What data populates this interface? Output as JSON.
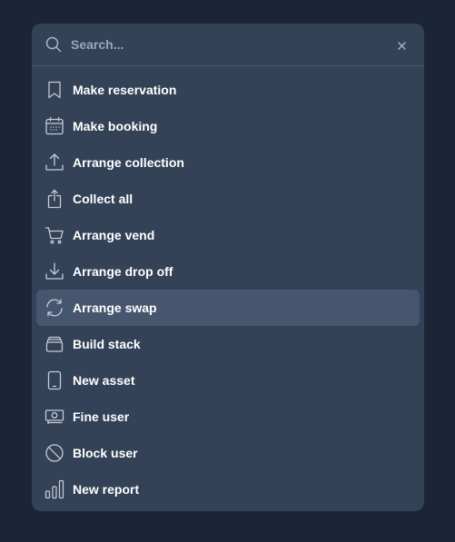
{
  "search": {
    "placeholder": "Search...",
    "value": ""
  },
  "items": [
    {
      "label": "Make reservation",
      "icon": "bookmark-icon",
      "active": false
    },
    {
      "label": "Make booking",
      "icon": "calendar-icon",
      "active": false
    },
    {
      "label": "Arrange collection",
      "icon": "upload-icon",
      "active": false
    },
    {
      "label": "Collect all",
      "icon": "share-icon",
      "active": false
    },
    {
      "label": "Arrange vend",
      "icon": "cart-icon",
      "active": false
    },
    {
      "label": "Arrange drop off",
      "icon": "download-icon",
      "active": false
    },
    {
      "label": "Arrange swap",
      "icon": "refresh-icon",
      "active": true
    },
    {
      "label": "Build stack",
      "icon": "stack-icon",
      "active": false
    },
    {
      "label": "New asset",
      "icon": "device-icon",
      "active": false
    },
    {
      "label": "Fine user",
      "icon": "banknote-icon",
      "active": false
    },
    {
      "label": "Block user",
      "icon": "block-icon",
      "active": false
    },
    {
      "label": "New report",
      "icon": "bar-chart-icon",
      "active": false
    }
  ],
  "colors": {
    "background": "#1b2537",
    "panel": "#334257",
    "active_item": "#46566e",
    "text": "#ffffff",
    "placeholder": "#9aa6b8"
  }
}
